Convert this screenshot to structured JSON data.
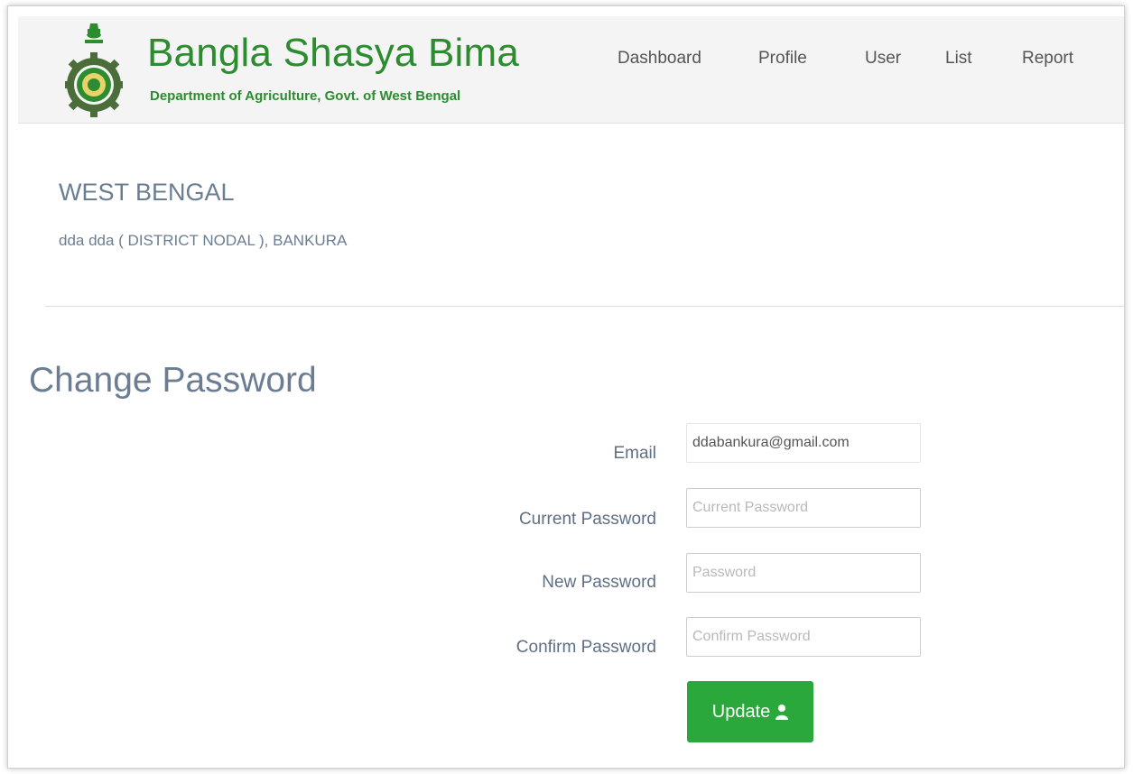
{
  "header": {
    "brand_title": "Bangla Shasya Bima",
    "brand_subtitle": "Department of Agriculture, Govt. of West Bengal",
    "logo_icon": "west-bengal-emblem-icon",
    "brand_color": "#2c8c2f",
    "nav": [
      {
        "label": "Dashboard"
      },
      {
        "label": "Profile"
      },
      {
        "label": "User"
      },
      {
        "label": "List"
      },
      {
        "label": "Report"
      }
    ]
  },
  "user_info": {
    "state": "WEST BENGAL",
    "user_line": "dda dda ( DISTRICT NODAL ), BANKURA"
  },
  "form": {
    "title": "Change Password",
    "email": {
      "label": "Email",
      "value": "ddabankura@gmail.com"
    },
    "current_password": {
      "label": "Current Password",
      "placeholder": "Current Password"
    },
    "new_password": {
      "label": "New Password",
      "placeholder": "Password"
    },
    "confirm_password": {
      "label": "Confirm Password",
      "placeholder": "Confirm Password"
    },
    "update_button": {
      "label": "Update",
      "icon": "user-icon",
      "color": "#2aa83b"
    }
  }
}
